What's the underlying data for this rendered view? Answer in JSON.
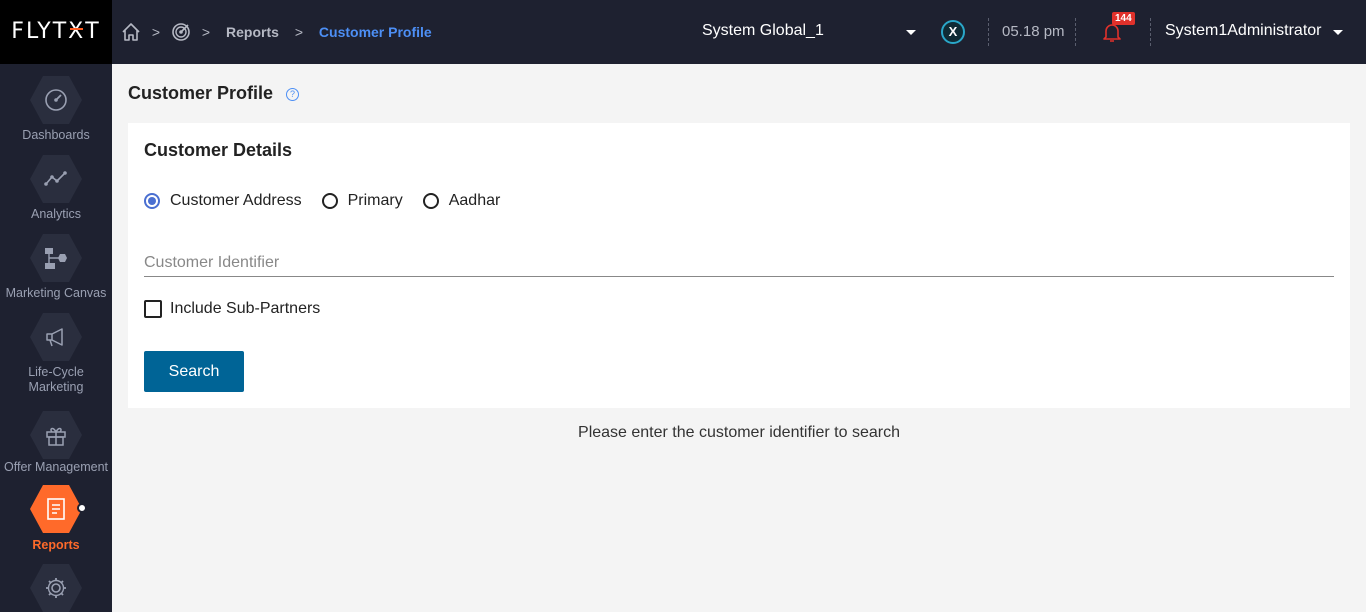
{
  "brand": {
    "logo_prefix": "FLYT",
    "logo_x": "X",
    "logo_suffix": "T"
  },
  "breadcrumb": {
    "items": [
      {
        "label": "Reports"
      },
      {
        "label": "Customer Profile"
      }
    ]
  },
  "header": {
    "org_selector": "System Global_1",
    "app_badge": "X",
    "time": "05.18 pm",
    "notifications_count": "144",
    "user_name": "System1Administrator"
  },
  "sidebar": {
    "items": [
      {
        "label": "Dashboards",
        "icon": "gauge-icon"
      },
      {
        "label": "Analytics",
        "icon": "line-chart-icon"
      },
      {
        "label": "Marketing Canvas",
        "icon": "flow-icon"
      },
      {
        "label_line1": "Life-Cycle",
        "label_line2": "Marketing",
        "icon": "megaphone-icon"
      },
      {
        "label": "Offer Management",
        "icon": "gift-icon"
      },
      {
        "label": "Reports",
        "icon": "report-icon",
        "active": true
      },
      {
        "label": "",
        "icon": "gear-icon"
      }
    ]
  },
  "page": {
    "title": "Customer Profile",
    "help": "?"
  },
  "form": {
    "section_title": "Customer Details",
    "radios": [
      {
        "label": "Customer Address",
        "checked": true
      },
      {
        "label": "Primary",
        "checked": false
      },
      {
        "label": "Aadhar",
        "checked": false
      }
    ],
    "identifier_placeholder": "Customer Identifier",
    "identifier_value": "",
    "include_subpartners_label": "Include Sub-Partners",
    "include_subpartners_checked": false,
    "search_label": "Search"
  },
  "hint": "Please enter the customer identifier to search",
  "colors": {
    "topbar": "#1e2130",
    "accent_orange": "#ff6a2a",
    "link_blue": "#4d8ff5",
    "button_blue": "#006496",
    "radio_blue": "#4a6fd1"
  }
}
